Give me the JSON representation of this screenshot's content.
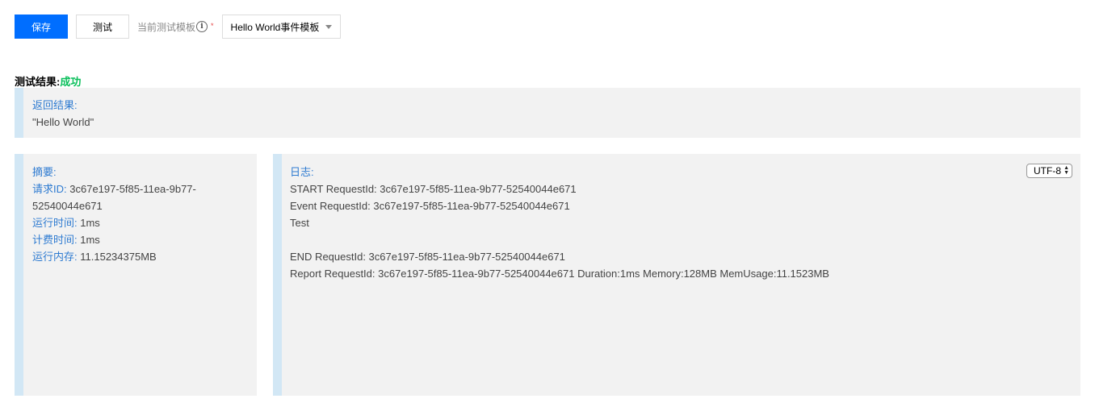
{
  "toolbar": {
    "save_label": "保存",
    "test_label": "测试",
    "template_label": "当前测试模板",
    "template_value": "Hello World事件模板"
  },
  "result": {
    "label": "测试结果:",
    "status": "成功",
    "status_color": "#0abf5b"
  },
  "return_panel": {
    "title": "返回结果:",
    "value": "\"Hello World\""
  },
  "summary": {
    "title": "摘要:",
    "request_id_label": "请求ID:",
    "request_id_value_part1": "3c67e197-5f85-11ea-9b77-",
    "request_id_value_part2": "52540044e671",
    "run_time_label": "运行时间:",
    "run_time_value": "1ms",
    "billed_time_label": "计费时间:",
    "billed_time_value": "1ms",
    "memory_label": "运行内存:",
    "memory_value": "11.15234375MB"
  },
  "log": {
    "title": "日志:",
    "encoding": "UTF-8",
    "lines": [
      "START RequestId: 3c67e197-5f85-11ea-9b77-52540044e671",
      "Event RequestId: 3c67e197-5f85-11ea-9b77-52540044e671",
      "Test",
      "",
      "END RequestId: 3c67e197-5f85-11ea-9b77-52540044e671",
      "Report RequestId: 3c67e197-5f85-11ea-9b77-52540044e671 Duration:1ms Memory:128MB MemUsage:11.1523MB"
    ]
  },
  "colors": {
    "primary": "#006eff",
    "label_blue": "#2e7bd1",
    "panel_bg": "#f2f2f2",
    "panel_accent": "#d2e7f5"
  }
}
